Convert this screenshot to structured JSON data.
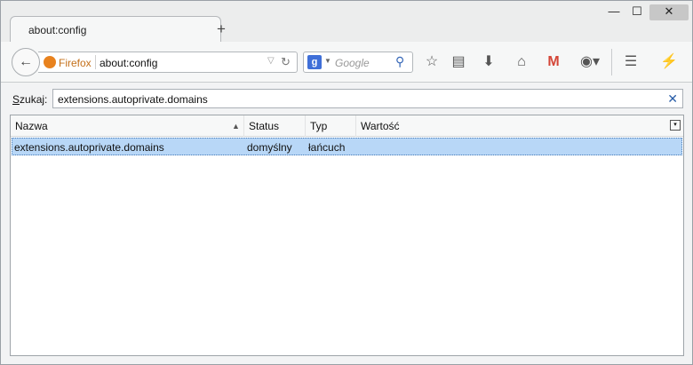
{
  "window": {
    "minimize": "—",
    "maximize": "☐",
    "close": "✕"
  },
  "tabs": [
    {
      "title": "about:config"
    }
  ],
  "new_tab": "+",
  "navbar": {
    "identity_label": "Firefox",
    "url": "about:config",
    "search_placeholder": "Google",
    "engine_letter": "g"
  },
  "filter": {
    "label_prefix": "S",
    "label_rest": "zukaj:",
    "value": "extensions.autoprivate.domains"
  },
  "table": {
    "columns": [
      "Nazwa",
      "Status",
      "Typ",
      "Wartość"
    ],
    "rows": [
      {
        "name": "extensions.autoprivate.domains",
        "status": "domyślny",
        "type": "łańcuch",
        "value": ""
      }
    ]
  },
  "colors": {
    "selection": "#b8d7f7",
    "firefox_orange": "#e8821e",
    "gmail_red": "#d44638"
  }
}
